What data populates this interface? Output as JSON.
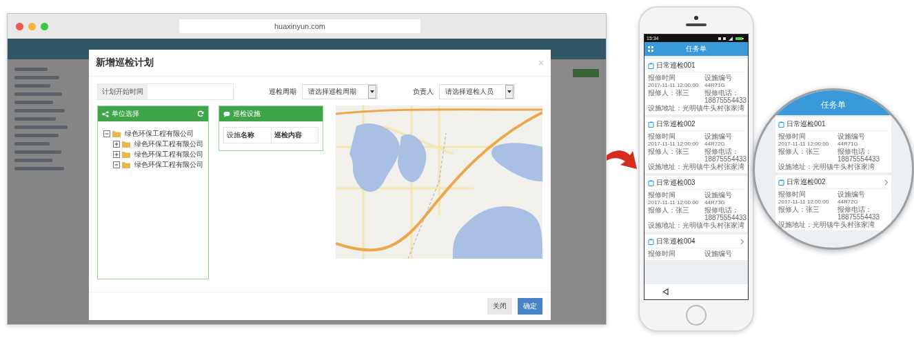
{
  "browser": {
    "url": "huaxinyun.com"
  },
  "dialog": {
    "title": "新增巡检计划",
    "form": {
      "start_time": {
        "label": "计划开始时间"
      },
      "cycle": {
        "label": "巡检周期",
        "placeholder": "请选择巡检周期"
      },
      "owner": {
        "label": "负责人",
        "placeholder": "请选择巡检人员"
      }
    },
    "unit_panel": {
      "title": "单位选择",
      "tree": [
        {
          "label": "绿色环保工程有限公司",
          "expanded": true,
          "children": [
            {
              "label": "绿色环保工程有限公司",
              "expanded": false
            },
            {
              "label": "绿色环保工程有限公司",
              "expanded": false
            },
            {
              "label": "绿色环保工程有限公司",
              "expanded": true
            }
          ]
        }
      ]
    },
    "facility_panel": {
      "title": "巡检设施",
      "columns": [
        "设施**名称**",
        "巡检内容"
      ]
    },
    "buttons": [
      {
        "label": "关闭",
        "kind": "secondary"
      },
      {
        "label": "确定",
        "kind": "primary"
      }
    ]
  },
  "phone": {
    "time": "15:34",
    "title": "任务单",
    "cards": [
      {
        "title": "日常巡检001",
        "rows": [
          {
            "left": "报修时间",
            "right": "设施编号"
          },
          {
            "left": "2017-11-11 12:00:00",
            "right": "44R71G"
          },
          {
            "left": "报修人：张三",
            "right": "报修电话：18875554433"
          }
        ],
        "address": "设施地址：光明镇牛头村张家湾",
        "chevron": false
      },
      {
        "title": "日常巡检002",
        "rows": [
          {
            "left": "报修时间",
            "right": "设施编号"
          },
          {
            "left": "2017-11-11 12:00:00",
            "right": "44R72G"
          },
          {
            "left": "报修人：张三",
            "right": "报修电话：18875554433"
          }
        ],
        "address": "设施地址：光明镇牛头村张家湾",
        "chevron": false
      },
      {
        "title": "日常巡检003",
        "rows": [
          {
            "left": "报修时间",
            "right": "设施编号"
          },
          {
            "left": "2017-11-11 12:00:00",
            "right": "44R73G"
          },
          {
            "left": "报修人：张三",
            "right": "报修电话：18875554433"
          }
        ],
        "address": "设施地址：光明镇牛头村张家湾",
        "chevron": false
      },
      {
        "title": "日常巡检004",
        "rows": [
          {
            "left": "报修时间",
            "right": "设施编号"
          }
        ],
        "chevron": true
      }
    ]
  },
  "magnifier": {
    "title": "任务单",
    "cards": [
      {
        "title": "日常巡检001",
        "rows": [
          {
            "left": "报修时间",
            "right": "设施编号"
          },
          {
            "left": "2017-11-11 12:00:00",
            "right": "44R71G"
          },
          {
            "left": "报修人：张三",
            "right": "报修电话：18875554433"
          }
        ],
        "address": "设施地址：光明镇牛头村张家湾",
        "chevron": false
      },
      {
        "title": "日常巡检002",
        "rows": [
          {
            "left": "报修时间",
            "right": "设施编号"
          },
          {
            "left": "2017-11-11 12:00:00",
            "right": "44R72G"
          },
          {
            "left": "报修人：张三",
            "right": "报修电话：18875554433"
          }
        ],
        "address": "设施地址：光明镇牛头村张家湾",
        "chevron": true
      }
    ]
  }
}
